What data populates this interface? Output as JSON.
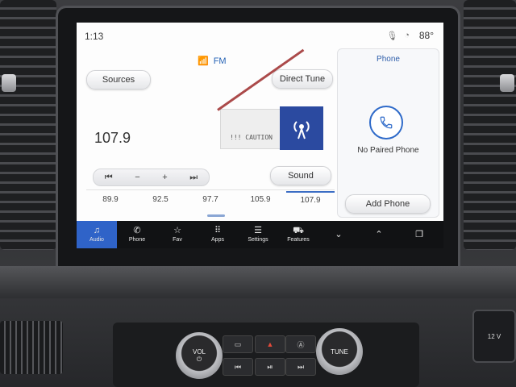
{
  "status": {
    "time": "1:13",
    "temperature": "88°"
  },
  "radio": {
    "band": "FM",
    "sources_label": "Sources",
    "direct_tune_label": "Direct Tune",
    "sound_label": "Sound",
    "current_frequency": "107.9",
    "artwork_text": "!!! CAUTION",
    "tune_controls": [
      "⏮",
      "−",
      "+",
      "⏭"
    ],
    "presets": [
      "89.9",
      "92.5",
      "97.7",
      "105.9",
      "107.9"
    ],
    "active_preset_index": 4
  },
  "phone_panel": {
    "title": "Phone",
    "status": "No Paired Phone",
    "add_phone_label": "Add Phone"
  },
  "nav": {
    "items": [
      {
        "label": "Audio",
        "icon": "music-note-icon"
      },
      {
        "label": "Phone",
        "icon": "phone-icon"
      },
      {
        "label": "Fav",
        "icon": "star-icon"
      },
      {
        "label": "Apps",
        "icon": "apps-grid-icon"
      },
      {
        "label": "Settings",
        "icon": "settings-sliders-icon"
      },
      {
        "label": "Features",
        "icon": "car-icon"
      }
    ],
    "active_index": 0
  },
  "hardware": {
    "vol_label": "VOL",
    "tune_label": "TUNE",
    "usb_label": "12 V"
  },
  "colors": {
    "accent": "#2f63c8",
    "phone_accent": "#2e6ac9",
    "hazard": "#e24a3a"
  }
}
